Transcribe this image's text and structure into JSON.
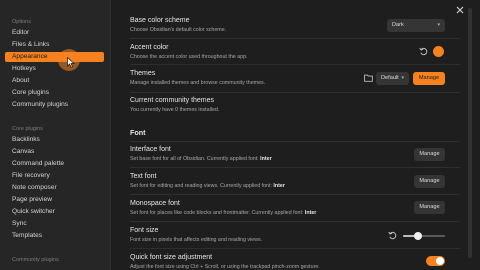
{
  "sidebar": {
    "options_heading": "Options",
    "options": [
      "Editor",
      "Files & Links",
      "Appearance",
      "Hotkeys",
      "About",
      "Core plugins",
      "Community plugins"
    ],
    "active_index": 2,
    "core_heading": "Core plugins",
    "core": [
      "Backlinks",
      "Canvas",
      "Command palette",
      "File recovery",
      "Note composer",
      "Page preview",
      "Quick switcher",
      "Sync",
      "Templates"
    ],
    "community_heading": "Community plugins"
  },
  "settings": {
    "base_color": {
      "title": "Base color scheme",
      "desc": "Choose Obsidian's default color scheme.",
      "value": "Dark"
    },
    "accent": {
      "title": "Accent color",
      "desc": "Choose the accent color used throughout the app.",
      "color": "#f5811f"
    },
    "themes": {
      "title": "Themes",
      "desc": "Manage installed themes and browse community themes.",
      "value": "Default",
      "button": "Manage"
    },
    "current_themes": {
      "title": "Current community themes",
      "desc": "You currently have 0 themes installed."
    },
    "font_heading": "Font",
    "interface_font": {
      "title": "Interface font",
      "desc_prefix": "Set base font for all of Obsidian. Currently applied font: ",
      "font": "Inter",
      "button": "Manage"
    },
    "text_font": {
      "title": "Text font",
      "desc_prefix": "Set font for editing and reading views. Currently applied font: ",
      "font": "Inter",
      "button": "Manage"
    },
    "mono_font": {
      "title": "Monospace font",
      "desc_prefix": "Set font for places like code blocks and frontmatter. Currently applied font: ",
      "font": "Inter",
      "button": "Manage"
    },
    "font_size": {
      "title": "Font size",
      "desc": "Font size in pixels that affects editing and reading views.",
      "slider_value": 0.35
    },
    "quick_font": {
      "title": "Quick font size adjustment",
      "desc": "Adjust the font size using Ctrl + Scroll, or using the trackpad pinch-zoom gesture.",
      "enabled": true
    }
  },
  "colors": {
    "accent": "#f5811f",
    "sidebar_bg": "#262626",
    "content_bg": "#1e1e1e"
  }
}
